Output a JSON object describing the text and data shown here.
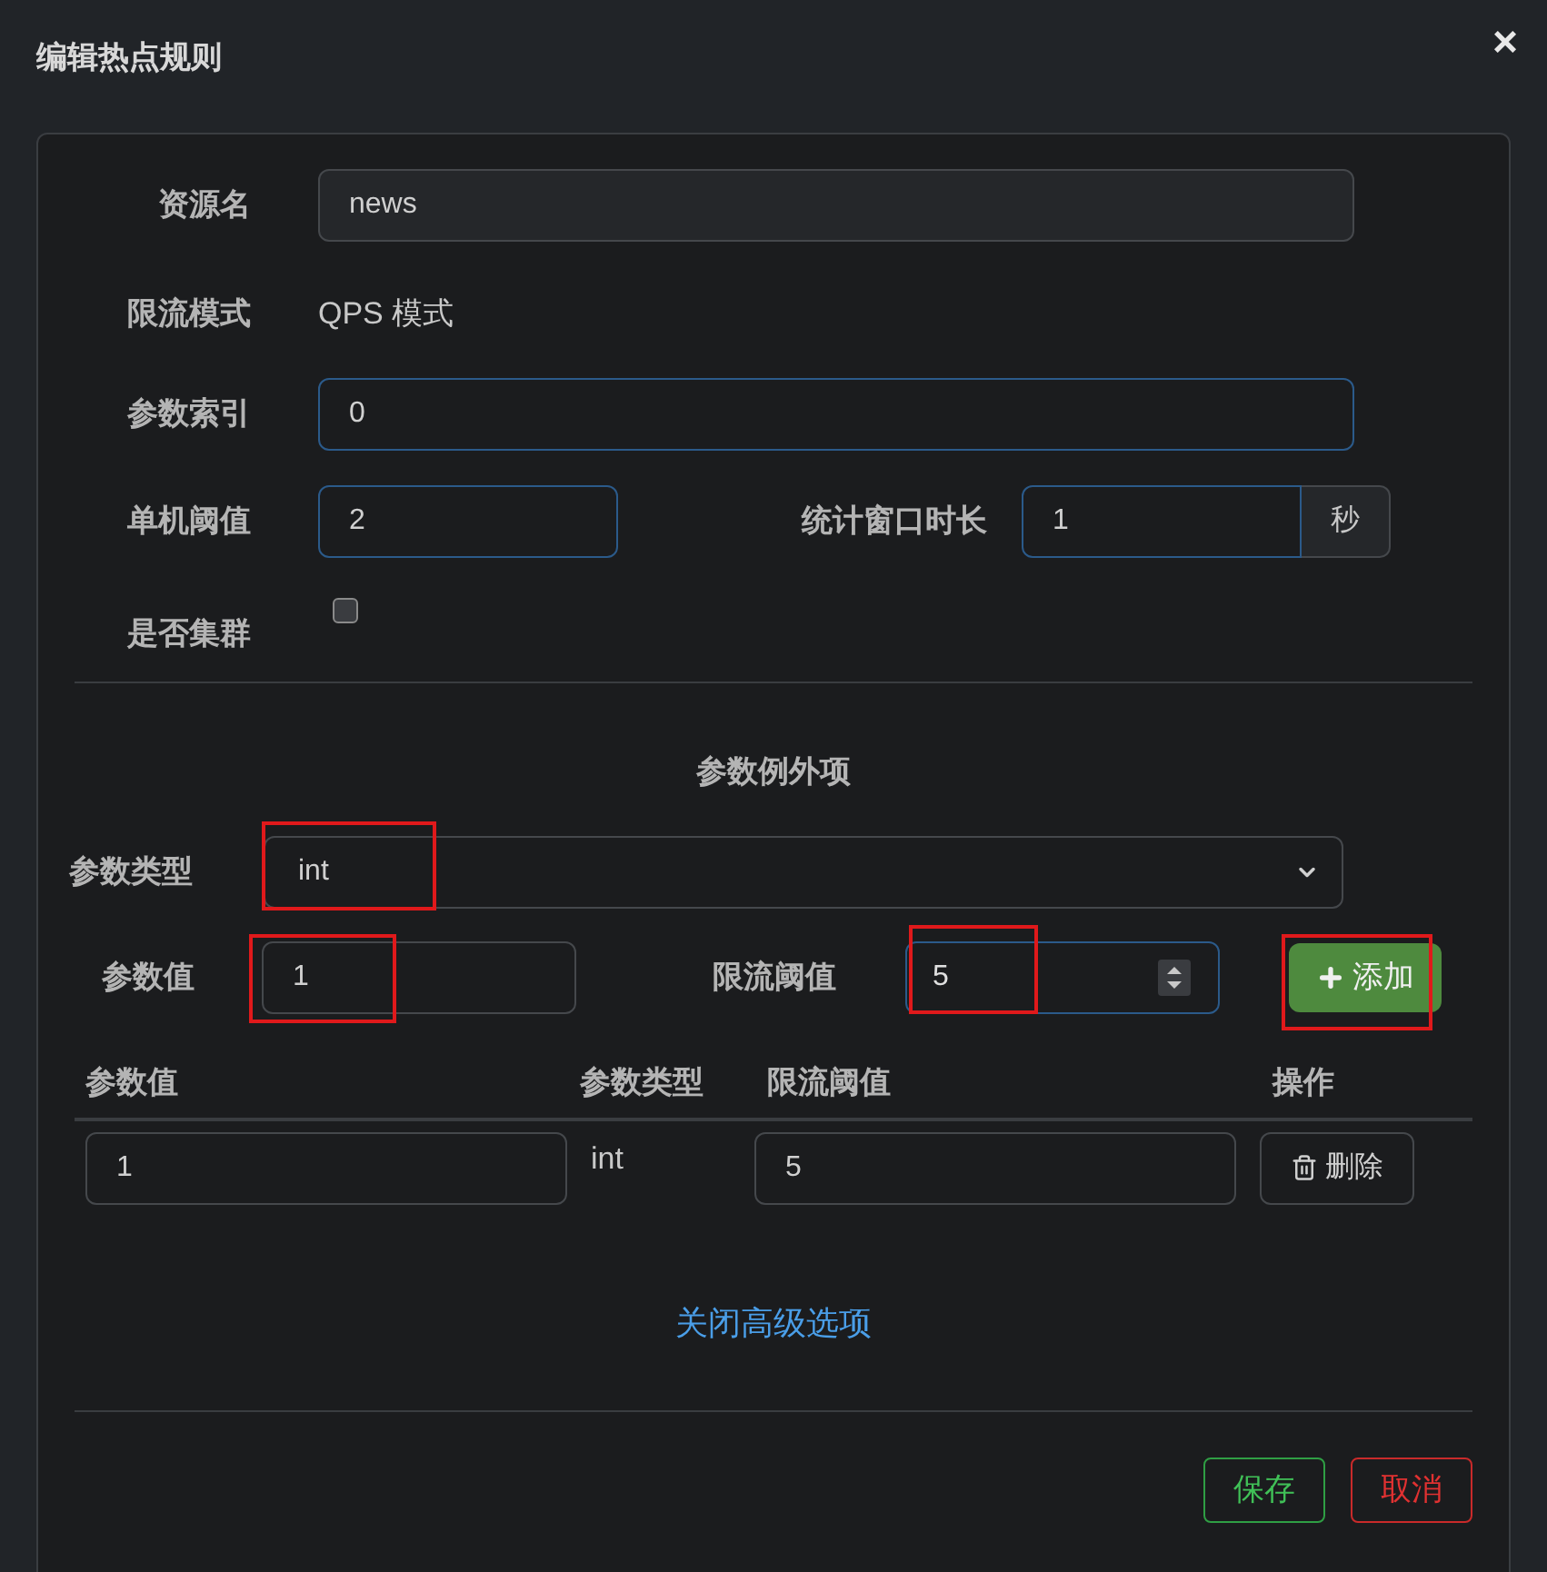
{
  "dialog": {
    "title": "编辑热点规则",
    "close_symbol": "×"
  },
  "resource": {
    "label": "资源名",
    "value": "news",
    "disabled": true
  },
  "mode": {
    "label": "限流模式",
    "value": "QPS 模式"
  },
  "param_index": {
    "label": "参数索引",
    "value": "0",
    "accent": true
  },
  "threshold": {
    "label": "单机阈值",
    "value": "2",
    "accent": true
  },
  "window": {
    "label": "统计窗口时长",
    "value": "1",
    "unit": "秒",
    "accent": true
  },
  "cluster": {
    "label": "是否集群",
    "checked": false
  },
  "exceptions": {
    "title": "参数例外项",
    "type_field": {
      "label": "参数类型",
      "value": "int",
      "marked": true
    },
    "value_field": {
      "label": "参数值",
      "value": "1",
      "marked": true,
      "accent": false
    },
    "limit_field": {
      "label": "限流阈值",
      "value": "5",
      "marked": true,
      "accent": true
    },
    "add_button": {
      "label": "添加",
      "marked": true
    },
    "table": {
      "columns": [
        "参数值",
        "参数类型",
        "限流阈值",
        "操作"
      ],
      "rows": [
        {
          "value": "1",
          "type": "int",
          "limit": "5",
          "action": "删除"
        }
      ]
    }
  },
  "advanced_link": "关闭高级选项",
  "buttons": [
    {
      "label": "保存",
      "kind": "save"
    },
    {
      "label": "取消",
      "kind": "cancel"
    }
  ]
}
